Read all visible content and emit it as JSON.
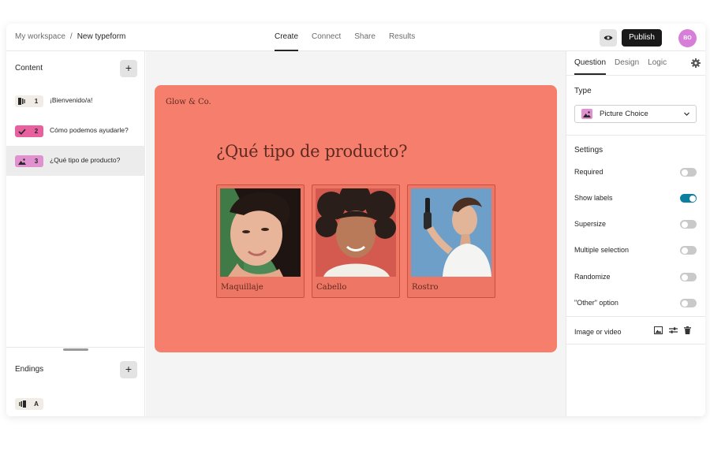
{
  "breadcrumb": {
    "workspace": "My workspace",
    "separator": "/",
    "current": "New typeform"
  },
  "nav_tabs": [
    {
      "label": "Create",
      "active": true
    },
    {
      "label": "Connect",
      "active": false
    },
    {
      "label": "Share",
      "active": false
    },
    {
      "label": "Results",
      "active": false
    }
  ],
  "header": {
    "preview_icon": "eye-icon",
    "publish_label": "Publish",
    "avatar_initials": "BO"
  },
  "content_panel": {
    "title": "Content",
    "add_label": "+",
    "questions": [
      {
        "number": "1",
        "label": "¡Bienvenido/a!",
        "icon": "welcome-screen-icon",
        "badge_color": "#f1ece6",
        "selected": false
      },
      {
        "number": "2",
        "label": "Cómo podemos ayudarle?",
        "icon": "checkmark-icon",
        "badge_color": "#e8609e",
        "selected": false
      },
      {
        "number": "3",
        "label": "¿Qué tipo de producto?",
        "icon": "picture-icon",
        "badge_color": "#e291d0",
        "selected": true
      }
    ],
    "endings_title": "Endings",
    "endings_add_label": "+",
    "endings": [
      {
        "number": "A",
        "icon": "ending-screen-icon",
        "badge_color": "#f1ece6"
      }
    ]
  },
  "preview": {
    "brand": "Glow & Co.",
    "question": "¿Qué tipo de producto?",
    "background_color": "#f57f6c",
    "choices": [
      {
        "label": "Maquillaje"
      },
      {
        "label": "Cabello"
      },
      {
        "label": "Rostro"
      }
    ]
  },
  "settings_panel": {
    "tabs": [
      {
        "label": "Question",
        "active": true
      },
      {
        "label": "Design",
        "active": false
      },
      {
        "label": "Logic",
        "active": false
      }
    ],
    "type_title": "Type",
    "type_value": "Picture Choice",
    "settings_title": "Settings",
    "settings": [
      {
        "label": "Required",
        "on": false
      },
      {
        "label": "Show labels",
        "on": true
      },
      {
        "label": "Supersize",
        "on": false
      },
      {
        "label": "Multiple selection",
        "on": false
      },
      {
        "label": "Randomize",
        "on": false
      },
      {
        "label": "\"Other\" option",
        "on": false
      }
    ],
    "media_label": "Image or video",
    "media_icons": [
      "image-icon",
      "adjust-icon",
      "trash-icon"
    ],
    "accent_color": "#0c7f9f"
  }
}
